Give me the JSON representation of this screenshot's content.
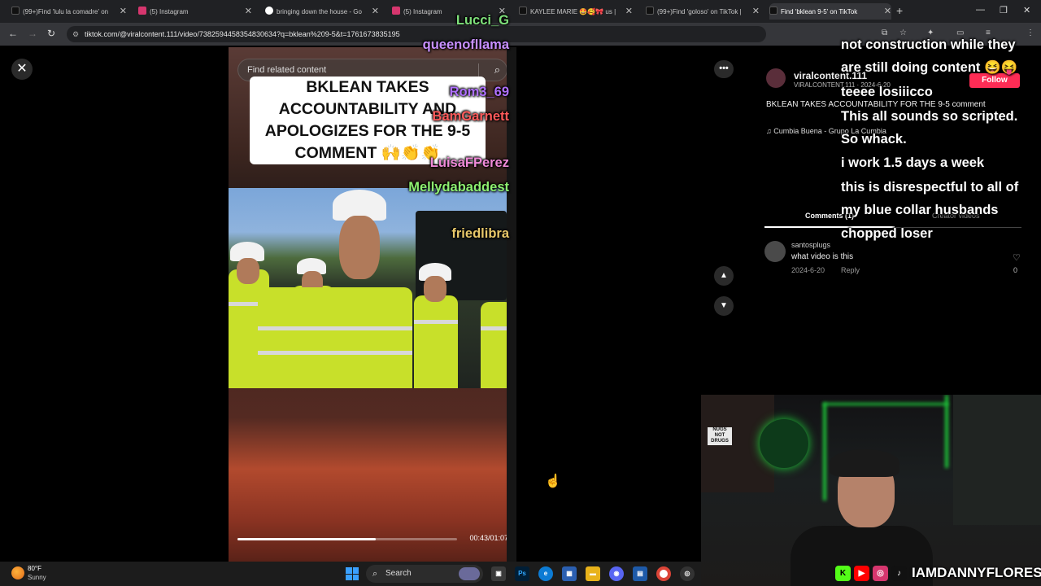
{
  "browser": {
    "tabs": [
      {
        "label": "(99+)Find 'lulu la comadre' on",
        "icon": "tiktok-icon"
      },
      {
        "label": "(5) Instagram",
        "icon": "instagram-icon"
      },
      {
        "label": "bringing down the house - Go",
        "icon": "google-icon"
      },
      {
        "label": "(5) Instagram",
        "icon": "instagram-icon"
      },
      {
        "label": "KAYLEE MARIE 🤩🥰🎀 us |",
        "icon": "tiktok-icon"
      },
      {
        "label": "(99+)Find 'goloso' on TikTok |",
        "icon": "tiktok-icon"
      },
      {
        "label": "Find 'bklean 9-5' on TikTok",
        "icon": "tiktok-icon"
      }
    ],
    "url": "tiktok.com/@viralcontent.111/video/7382594458354830634?q=bklean%209-5&t=1761673835195"
  },
  "video": {
    "search_placeholder": "Find related content",
    "caption": "BKLEAN TAKES ACCOUNTABILITY AND APOLOGIZES FOR THE 9-5 COMMENT 🙌👏👏",
    "progress_fraction": 0.63,
    "timecode": "00:43/01:07"
  },
  "info": {
    "username": "viralcontent.111",
    "subtitle": "VIRALCONTENT.111 · 2024-6-20",
    "follow_label": "Follow",
    "description": "BKLEAN TAKES ACCOUNTABILITY FOR THE 9-5 comment",
    "music": "♫  Cumbia Buena - Grupo La Cumbia",
    "tab_comments": "Comments (1)",
    "tab_creator": "Creator videos",
    "comment": {
      "user": "santosplugs",
      "text": "what video is this",
      "date": "2024-6-20",
      "reply": "Reply",
      "likes": "0"
    }
  },
  "chat": [
    {
      "user": "Lucci_G",
      "text": "",
      "color": "#7ee07a"
    },
    {
      "user": "queenofllama",
      "text": "not construction while they",
      "color": "#c890ff"
    },
    {
      "user": "",
      "text": "are still doing content 😆😝",
      "color": "#ffffff"
    },
    {
      "user": "Rom3_69",
      "text": "teeee losiiicco",
      "color": "#b070ff"
    },
    {
      "user": "BamGarnett",
      "text": "This all sounds so scripted.",
      "color": "#ff5a5a"
    },
    {
      "user": "",
      "text": "So whack.",
      "color": "#ffffff"
    },
    {
      "user": "LuisaFPerez",
      "text": "i work 1.5 days a week",
      "color": "#f08ad8"
    },
    {
      "user": "Mellydabaddest",
      "text": "this is disrespectful to all of",
      "color": "#8ef070"
    },
    {
      "user": "",
      "text": "my blue collar husbands",
      "color": "#ffffff"
    },
    {
      "user": "friedlibra",
      "text": "chopped loser",
      "color": "#e8c86a"
    }
  ],
  "stream": {
    "handle": "IAMDANNYFLORES",
    "sign_text": "NUGS NOT DRUGS",
    "socials": [
      "K",
      "▶",
      "◎",
      "♪"
    ]
  },
  "taskbar": {
    "temperature": "80°F",
    "condition": "Sunny",
    "search_label": "Search"
  },
  "colors": {
    "follow": "#fe2c55",
    "accent_green": "#1ec83a"
  }
}
